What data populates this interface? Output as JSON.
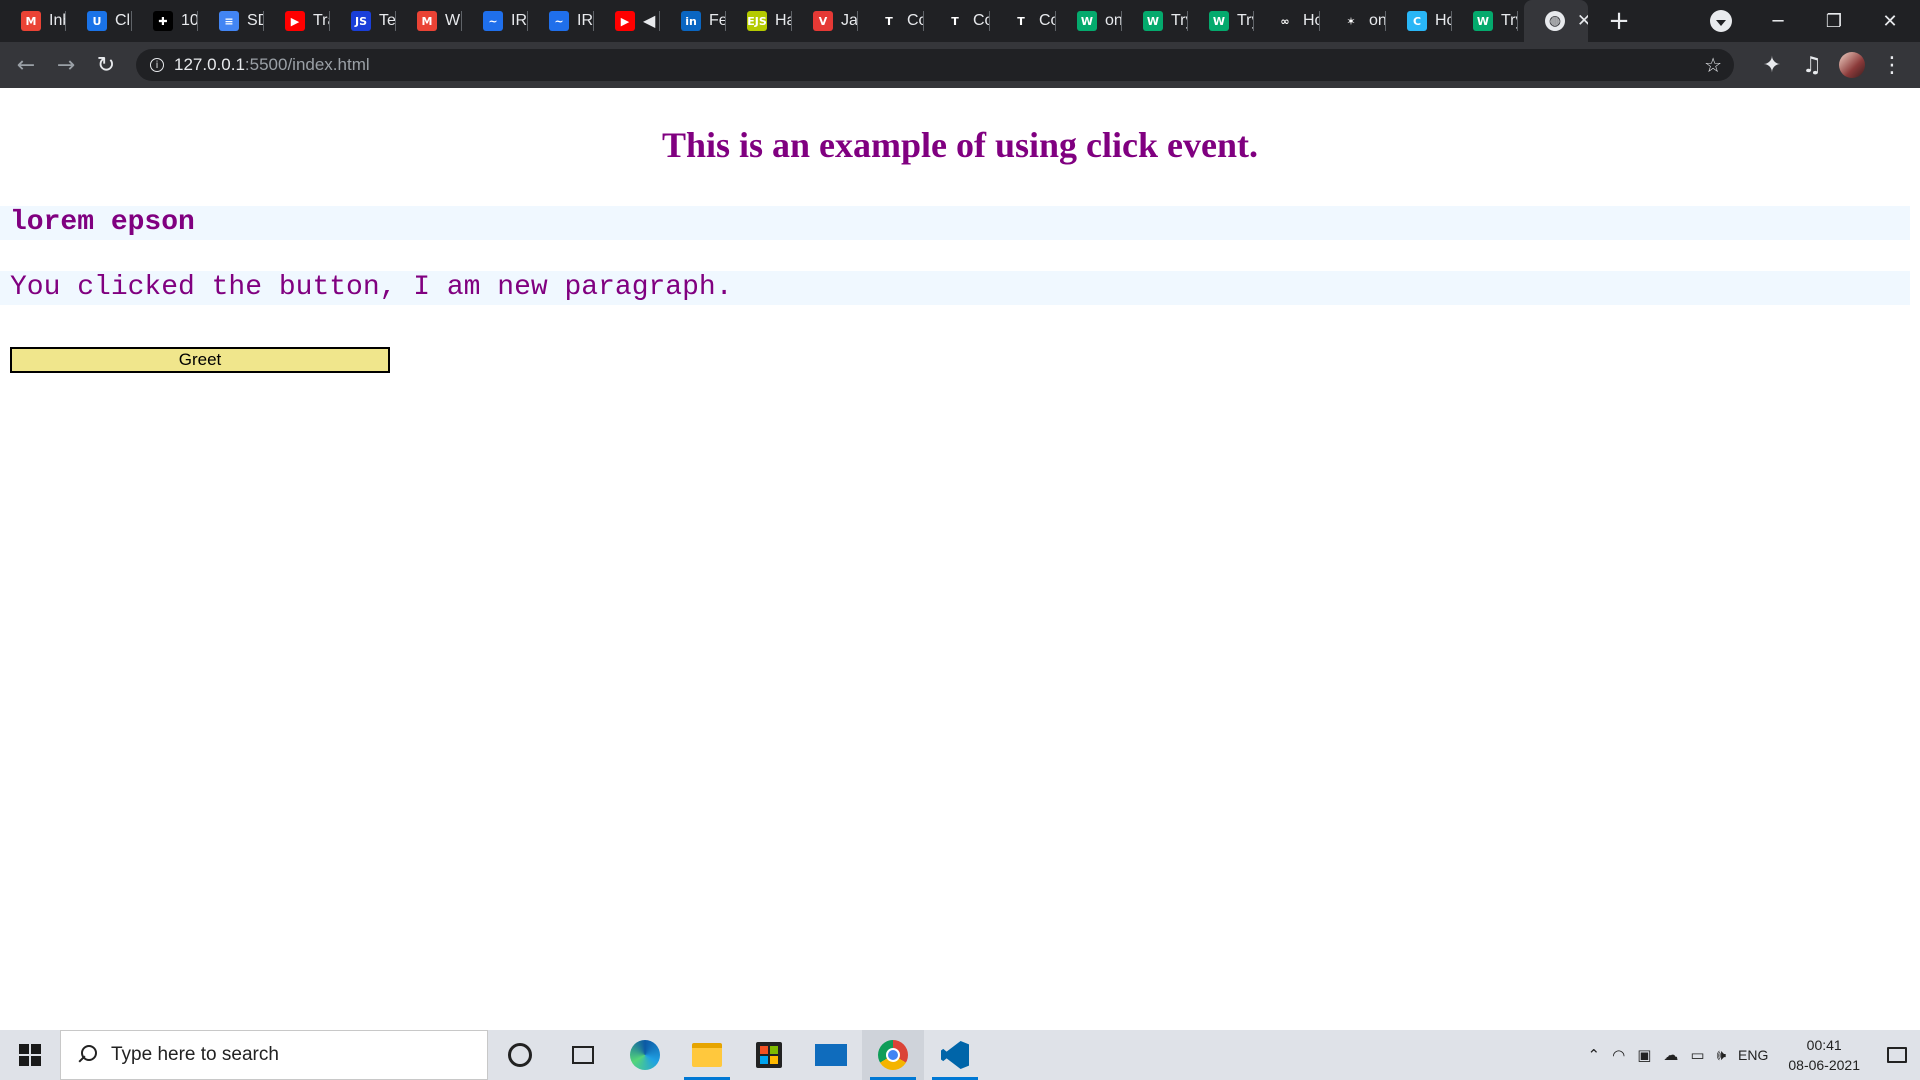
{
  "browser": {
    "tabs": [
      {
        "title": "Inbox",
        "icon": "gmail-icon",
        "fav_text": "M",
        "fav_color": "#ea4335"
      },
      {
        "title": "Click",
        "icon": "u-icon",
        "fav_text": "U",
        "fav_color": "#1a73e8"
      },
      {
        "title": "10",
        "icon": "plus-badge-icon",
        "fav_text": "✚",
        "fav_color": "#000000"
      },
      {
        "title": "SD",
        "icon": "docs-icon",
        "fav_text": "≡",
        "fav_color": "#4285f4"
      },
      {
        "title": "Tra",
        "icon": "youtube-icon",
        "fav_text": "▶",
        "fav_color": "#ff0000"
      },
      {
        "title": "Te",
        "icon": "js-icon",
        "fav_text": "JS",
        "fav_color": "#1a3fd9"
      },
      {
        "title": "Wi",
        "icon": "gmail-icon",
        "fav_text": "M",
        "fav_color": "#ea4335"
      },
      {
        "title": "IRI",
        "icon": "wave-icon",
        "fav_text": "~",
        "fav_color": "#1f6feb"
      },
      {
        "title": "IRI",
        "icon": "wave-icon",
        "fav_text": "~",
        "fav_color": "#1f6feb"
      },
      {
        "title": "◀",
        "icon": "youtube-icon",
        "fav_text": "▶",
        "fav_color": "#ff0000"
      },
      {
        "title": "Fe",
        "icon": "linkedin-icon",
        "fav_text": "in",
        "fav_color": "#0a66c2"
      },
      {
        "title": "Ha",
        "icon": "ejs-icon",
        "fav_text": "EJS",
        "fav_color": "#b4ca00"
      },
      {
        "title": "Jav",
        "icon": "v-icon",
        "fav_text": "V",
        "fav_color": "#e53935"
      },
      {
        "title": "Co",
        "icon": "t-icon",
        "fav_text": "T",
        "fav_color": "#202124"
      },
      {
        "title": "Co",
        "icon": "t-icon",
        "fav_text": "T",
        "fav_color": "#202124"
      },
      {
        "title": "Co",
        "icon": "t-icon",
        "fav_text": "T",
        "fav_color": "#202124"
      },
      {
        "title": "on",
        "icon": "w3-icon",
        "fav_text": "W",
        "fav_color": "#04aa6d"
      },
      {
        "title": "Try",
        "icon": "w3-icon",
        "fav_text": "W",
        "fav_color": "#04aa6d"
      },
      {
        "title": "Try",
        "icon": "w3-icon",
        "fav_text": "W",
        "fav_color": "#04aa6d"
      },
      {
        "title": "Hc",
        "icon": "link-icon",
        "fav_text": "∞",
        "fav_color": "#202124"
      },
      {
        "title": "on",
        "icon": "star-burst-icon",
        "fav_text": "✶",
        "fav_color": "#202124"
      },
      {
        "title": "Hc",
        "icon": "c-icon",
        "fav_text": "C",
        "fav_color": "#29b6f6"
      },
      {
        "title": "Try",
        "icon": "w3-icon",
        "fav_text": "W",
        "fav_color": "#04aa6d"
      }
    ],
    "active_tab": {
      "icon": "globe-icon",
      "close": "✕"
    },
    "new_tab": "+",
    "window_controls": {
      "minimize": "─",
      "restore": "❐",
      "close": "✕"
    },
    "url_host": "127.0.0.1",
    "url_path": ":5500/index.html"
  },
  "page": {
    "heading": "This is an example of using click event.",
    "lorem_text": "lorem epson",
    "new_paragraph": "You clicked the button, I am new paragraph.",
    "greet_button": "Greet"
  },
  "taskbar": {
    "search_placeholder": "Type here to search",
    "language": "ENG",
    "time": "00:41",
    "date": "08-06-2021"
  },
  "colors": {
    "accent": "#800080",
    "paragraph_bg": "#f0f8ff",
    "button_bg": "#f0e68c"
  }
}
